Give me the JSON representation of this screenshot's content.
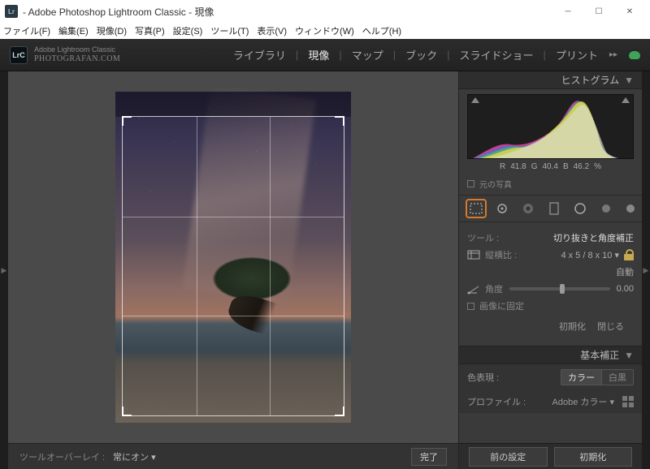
{
  "window": {
    "title": "- Adobe Photoshop Lightroom Classic - 現像"
  },
  "menu": {
    "file": "ファイル(F)",
    "edit": "編集(E)",
    "develop": "現像(D)",
    "photo": "写真(P)",
    "settings": "設定(S)",
    "tool": "ツール(T)",
    "view": "表示(V)",
    "window": "ウィンドウ(W)",
    "help": "ヘルプ(H)"
  },
  "brand": {
    "line1": "Adobe Lightroom Classic",
    "line2": "PhotograFan.com"
  },
  "modules": {
    "library": "ライブラリ",
    "develop": "現像",
    "map": "マップ",
    "book": "ブック",
    "slideshow": "スライドショー",
    "print": "プリント"
  },
  "overlay": {
    "label": "ツールオーバーレイ :",
    "value": "常にオン",
    "done": "完了"
  },
  "panel": {
    "histogram": {
      "title": "ヒストグラム",
      "r": "R",
      "rval": "41.8",
      "g": "G",
      "gval": "40.4",
      "b": "B",
      "bval": "46.2",
      "pct": "%",
      "original": "元の写真"
    },
    "tool_section": {
      "tool_label": "ツール :",
      "tool_name": "切り抜きと角度補正",
      "aspect_label": "縦横比 :",
      "aspect_value": "4 x 5 / 8 x 10",
      "auto": "自動",
      "angle_label": "角度",
      "angle_value": "0.00",
      "lock_label": "画像に固定",
      "reset": "初期化",
      "close": "閉じる"
    },
    "basic": {
      "title": "基本補正",
      "treatment": "色表現 :",
      "color": "カラー",
      "bw": "白黒",
      "profile_label": "プロファイル :",
      "profile_value": "Adobe カラー"
    }
  },
  "bottom": {
    "prev": "前の設定",
    "reset": "初期化"
  }
}
